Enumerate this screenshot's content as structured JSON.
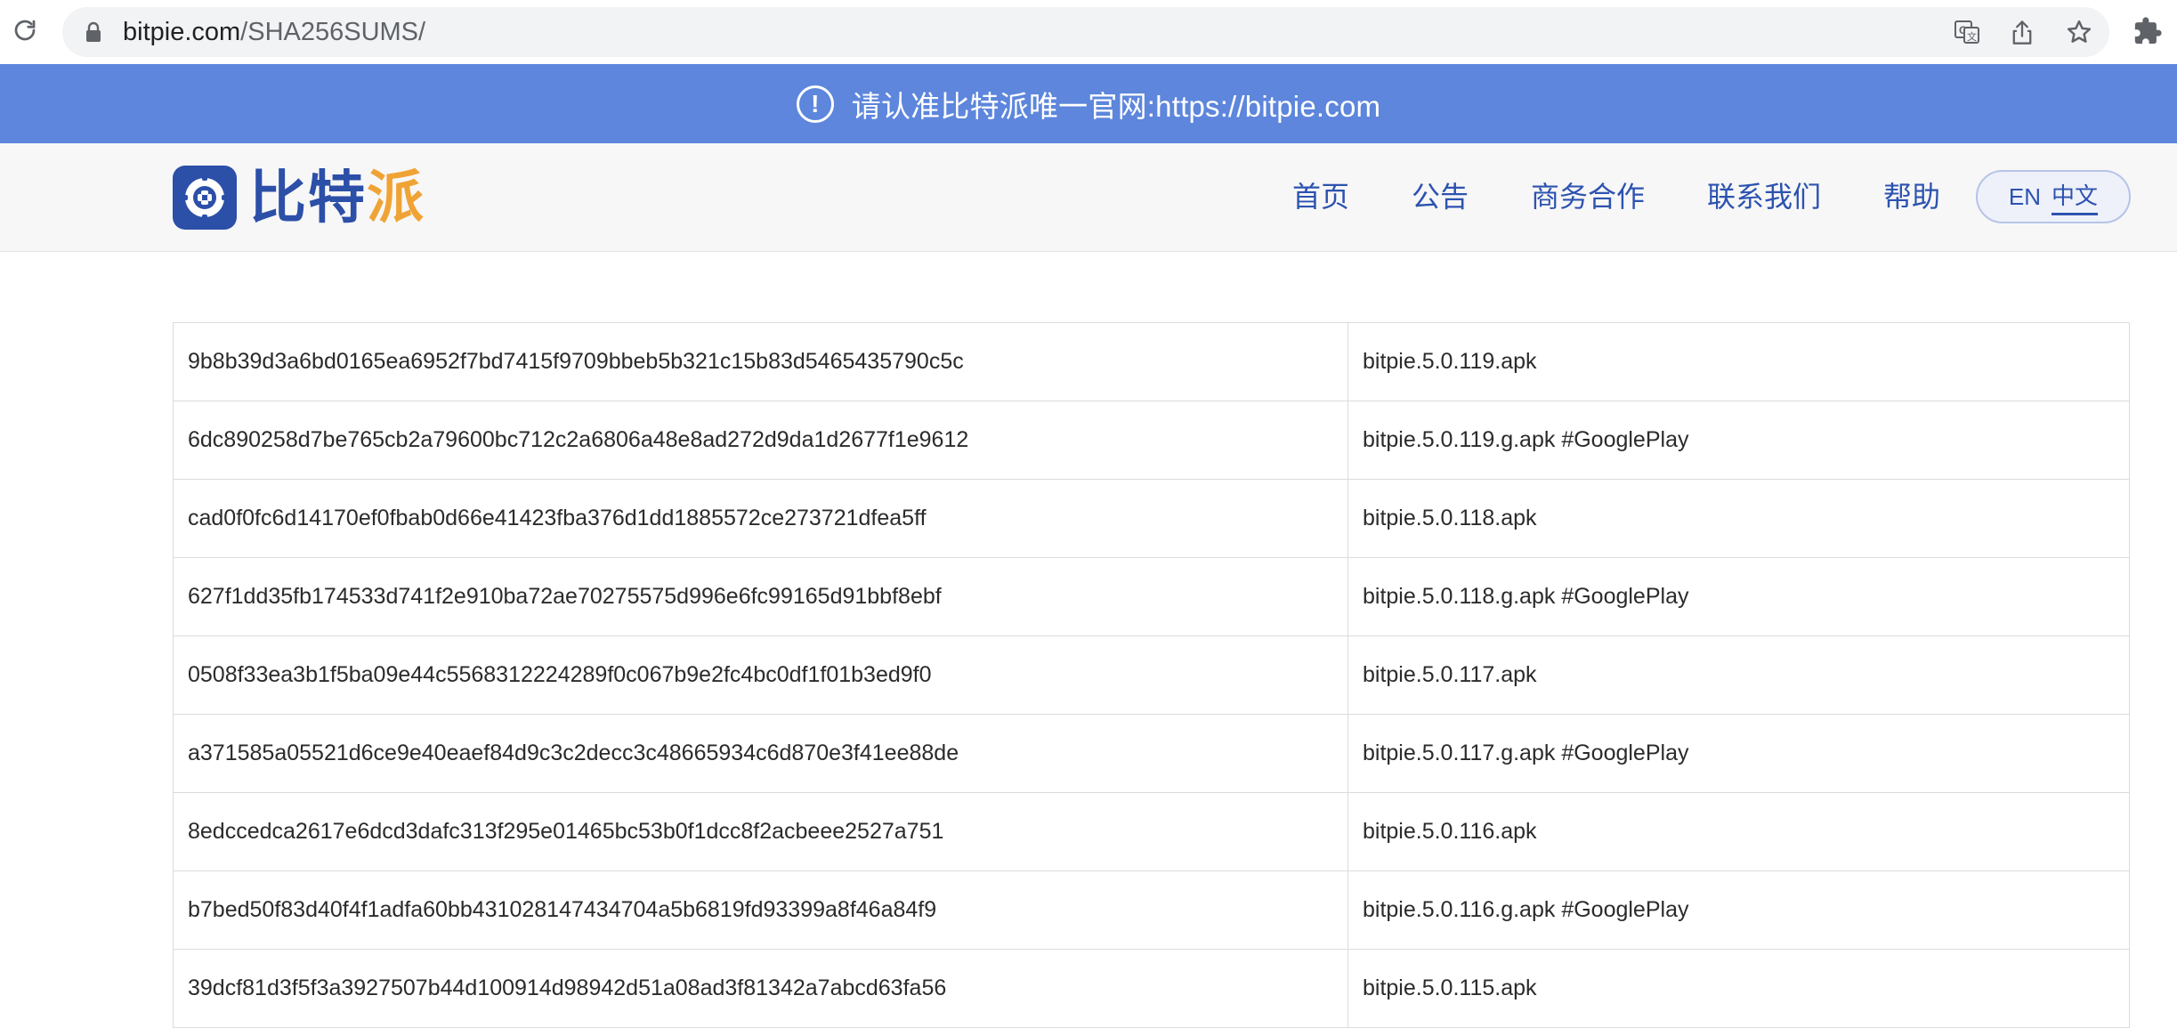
{
  "browser": {
    "url_host": "bitpie.com",
    "url_path": "/SHA256SUMS/"
  },
  "notice": {
    "icon": "exclamation-circle-icon",
    "text": "请认准比特派唯一官网:https://bitpie.com"
  },
  "header": {
    "logo_text_main": "比特",
    "logo_text_accent": "派",
    "nav": [
      "首页",
      "公告",
      "商务合作",
      "联系我们",
      "帮助"
    ],
    "lang": {
      "en": "EN",
      "zh": "中文",
      "active": "中文"
    }
  },
  "colors": {
    "notice_bg": "#5d86dc",
    "brand_blue": "#2c4fa8",
    "brand_orange": "#f0a335",
    "nav_text": "#2d53b0"
  },
  "table": {
    "rows": [
      {
        "hash": "9b8b39d3a6bd0165ea6952f7bd7415f9709bbeb5b321c15b83d5465435790c5c",
        "file": "bitpie.5.0.119.apk"
      },
      {
        "hash": "6dc890258d7be765cb2a79600bc712c2a6806a48e8ad272d9da1d2677f1e9612",
        "file": "bitpie.5.0.119.g.apk #GooglePlay"
      },
      {
        "hash": "cad0f0fc6d14170ef0fbab0d66e41423fba376d1dd1885572ce273721dfea5ff",
        "file": "bitpie.5.0.118.apk"
      },
      {
        "hash": "627f1dd35fb174533d741f2e910ba72ae70275575d996e6fc99165d91bbf8ebf",
        "file": "bitpie.5.0.118.g.apk #GooglePlay"
      },
      {
        "hash": "0508f33ea3b1f5ba09e44c5568312224289f0c067b9e2fc4bc0df1f01b3ed9f0",
        "file": "bitpie.5.0.117.apk"
      },
      {
        "hash": "a371585a05521d6ce9e40eaef84d9c3c2decc3c48665934c6d870e3f41ee88de",
        "file": "bitpie.5.0.117.g.apk #GooglePlay"
      },
      {
        "hash": "8edccedca2617e6dcd3dafc313f295e01465bc53b0f1dcc8f2acbeee2527a751",
        "file": "bitpie.5.0.116.apk"
      },
      {
        "hash": "b7bed50f83d40f4f1adfa60bb431028147434704a5b6819fd93399a8f46a84f9",
        "file": "bitpie.5.0.116.g.apk #GooglePlay"
      },
      {
        "hash": "39dcf81d3f5f3a3927507b44d100914d98942d51a08ad3f81342a7abcd63fa56",
        "file": "bitpie.5.0.115.apk"
      }
    ]
  }
}
